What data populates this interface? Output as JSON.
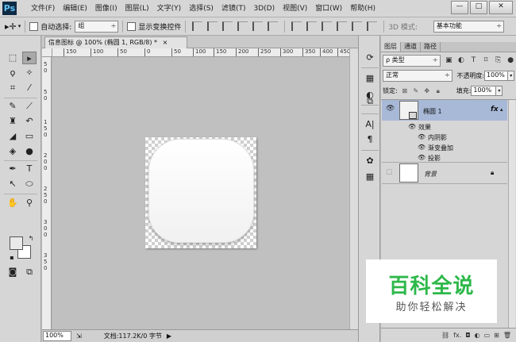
{
  "app": {
    "logo": "Ps"
  },
  "menu": [
    "文件(F)",
    "编辑(E)",
    "图像(I)",
    "图层(L)",
    "文字(Y)",
    "选择(S)",
    "滤镜(T)",
    "3D(D)",
    "视图(V)",
    "窗口(W)",
    "帮助(H)"
  ],
  "window_buttons": {
    "minimize": "—",
    "maximize": "□",
    "close": "✕"
  },
  "options": {
    "auto_select_label": "自动选择:",
    "auto_select_value": "组",
    "show_transform_label": "显示变换控件",
    "mode_3d_label": "3D 模式:",
    "workspace_value": "基本功能"
  },
  "document": {
    "tab_title": "信息图标 @ 100% (椭圆 1, RGB/8) *",
    "close_glyph": "×",
    "ruler_top": [
      "150",
      "100",
      "50",
      "0",
      "50",
      "100",
      "150",
      "200",
      "250",
      "300",
      "350",
      "400",
      "450"
    ],
    "ruler_left": [
      "5",
      "0",
      "5",
      "0",
      "1",
      "5",
      "0",
      "2",
      "0",
      "0",
      "2",
      "5",
      "0",
      "3",
      "0",
      "0",
      "3",
      "5",
      "0"
    ]
  },
  "status": {
    "zoom": "100%",
    "doc_info": "文档:117.2K/0 字节",
    "arrow": "▶"
  },
  "layers_panel": {
    "tabs": [
      "图层",
      "通道",
      "路径"
    ],
    "kind_value": "ρ 类型",
    "blend_mode": "正常",
    "opacity_label": "不透明度:",
    "opacity_value": "100%",
    "lock_label": "锁定:",
    "fill_label": "填充:",
    "fill_value": "100%",
    "layers": [
      {
        "name": "椭圆 1",
        "fx": "fx",
        "selected": true
      },
      {
        "name": "背景",
        "fx": "",
        "selected": false
      }
    ],
    "effects_label": "效果",
    "effects": [
      "内阴影",
      "渐变叠加",
      "投影"
    ]
  },
  "watermark": {
    "main": "百科全说",
    "sub": "助你轻松解决"
  },
  "colors": {
    "selection_highlight": "#a8b9d8",
    "watermark_green": "#2eb84a"
  }
}
